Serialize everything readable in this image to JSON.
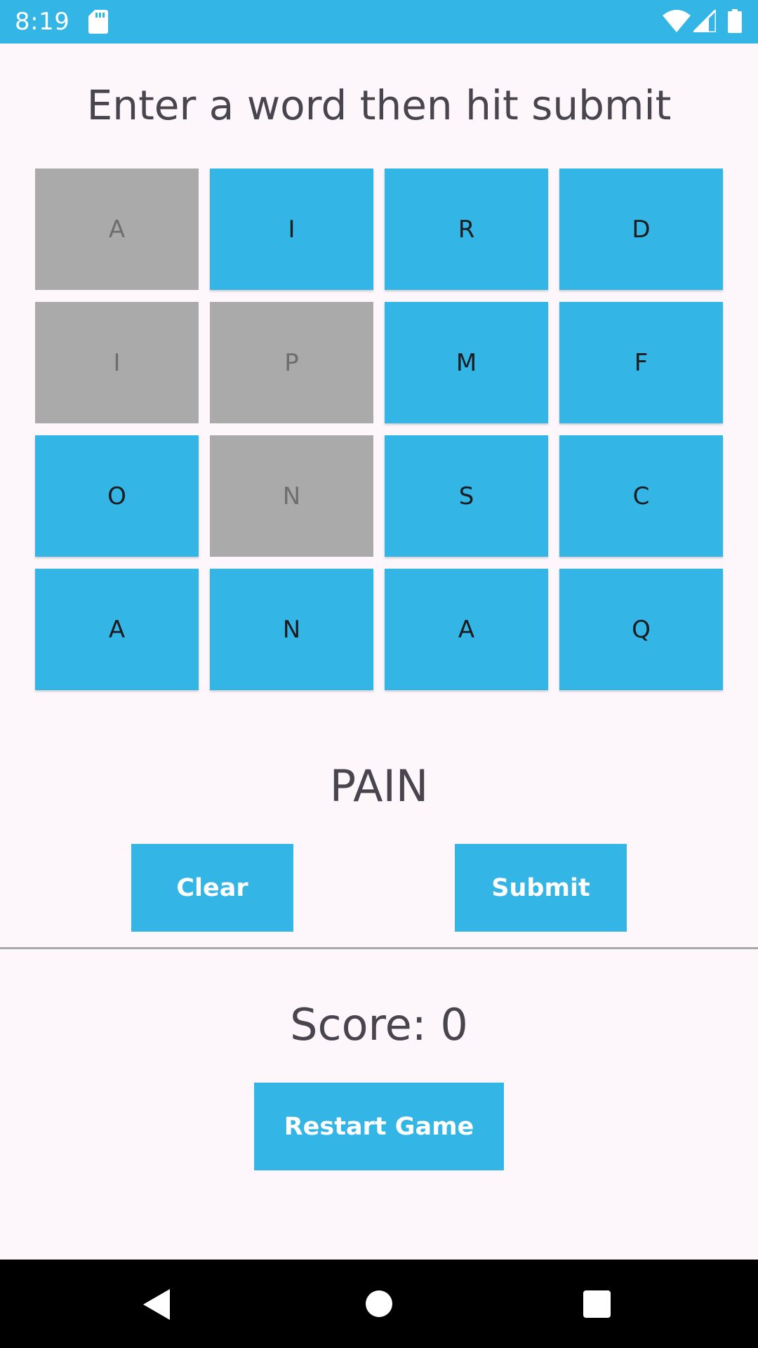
{
  "status_bar": {
    "time": "8:19",
    "icons": [
      "sd-card-icon",
      "wifi-icon",
      "cell-signal-icon",
      "battery-icon"
    ]
  },
  "instruction": "Enter a word then hit submit",
  "grid": {
    "rows": [
      [
        {
          "letter": "A",
          "state": "used"
        },
        {
          "letter": "I",
          "state": "active"
        },
        {
          "letter": "R",
          "state": "active"
        },
        {
          "letter": "D",
          "state": "active"
        }
      ],
      [
        {
          "letter": "I",
          "state": "used"
        },
        {
          "letter": "P",
          "state": "used"
        },
        {
          "letter": "M",
          "state": "active"
        },
        {
          "letter": "F",
          "state": "active"
        }
      ],
      [
        {
          "letter": "O",
          "state": "active"
        },
        {
          "letter": "N",
          "state": "used"
        },
        {
          "letter": "S",
          "state": "active"
        },
        {
          "letter": "C",
          "state": "active"
        }
      ],
      [
        {
          "letter": "A",
          "state": "active"
        },
        {
          "letter": "N",
          "state": "active"
        },
        {
          "letter": "A",
          "state": "active"
        },
        {
          "letter": "Q",
          "state": "active"
        }
      ]
    ]
  },
  "current_word": "PAIN",
  "buttons": {
    "clear": "Clear",
    "submit": "Submit",
    "restart": "Restart Game"
  },
  "score": "Score: 0",
  "colors": {
    "accent": "#33B5E5",
    "used_tile": "#AAAAAA",
    "background": "#FDF7FC",
    "text": "#49454F"
  },
  "nav_bar": {
    "icons": [
      "back-icon",
      "home-icon",
      "recents-icon"
    ]
  }
}
